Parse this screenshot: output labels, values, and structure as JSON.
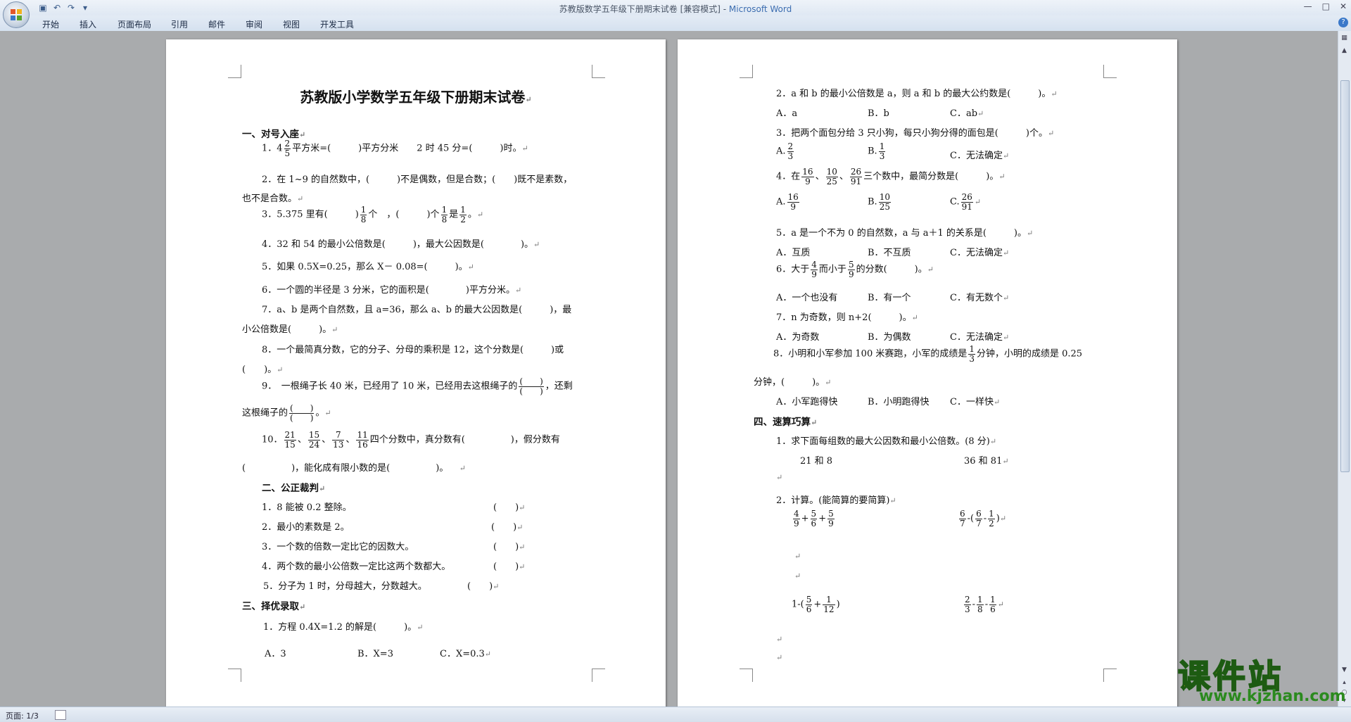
{
  "window": {
    "title": "苏教版数学五年级下册期末试卷 [兼容模式] - ",
    "app_name": "Microsoft Word"
  },
  "ribbon_tabs": [
    "开始",
    "插入",
    "页面布局",
    "引用",
    "邮件",
    "审阅",
    "视图",
    "开发工具"
  ],
  "status_bar": {
    "page": "页面: 1/3"
  },
  "watermark": {
    "text": "课件站",
    "url": "www.kjzhan.com"
  },
  "document": {
    "title": "苏教版小学数学五年级下册期末试卷",
    "left": {
      "s1": "一、对号入座",
      "q1a": "1．4",
      "q1b": "平方米=(　　　)平方分米　　2 时 45 分=(　　　)时。",
      "q2a": "2．在 1~9 的自然数中，(　　　)不是偶数，但是合数；(　　)既不是素数，",
      "q2b": "也不是合数。",
      "q3a": "3．5.375 里有(　　　)",
      "q3b": "个　，(　　　)个",
      "q3c": "是",
      "q3d": "。",
      "q4": "4．32 和 54 的最小公倍数是(　　　)，最大公因数是(　　　　)。",
      "q5": "5．如果 0.5X=0.25，那么 X－ 0.08=(　　　)。",
      "q6": "6．一个圆的半径是 3 分米，它的面积是(　　　　)平方分米。",
      "q7a": "7．a、b 是两个自然数，且 a=36，那么 a、b 的最大公因数是(　　　)，最",
      "q7b": "小公倍数是(　　　)。",
      "q8a": "8．一个最简真分数，它的分子、分母的乘积是 12，这个分数是(　　　)或",
      "q8b": "(　　)。",
      "q9a": "9．　一根绳子长 40 米，已经用了 10 米，已经用去这根绳子的",
      "q9b": "，还剩",
      "q9c": "这根绳子的",
      "q9d": "。",
      "q10a": "10．",
      "q10b": "四个分数中，真分数有(　　　　　)，假分数有",
      "q10c": "(　　　　　)，能化成有限小数的是(　　　　　)。",
      "s2": "二、公正裁判",
      "j1": "1．8 能被 0.2 整除。",
      "j2": "2．最小的素数是 2。",
      "j3": "3．一个数的倍数一定比它的因数大。",
      "j4": "4．两个数的最小公倍数一定比这两个数都大。",
      "j5": "5．分子为 1 时，分母越大，分数越大。",
      "blank": "(　　)",
      "s3": "三、择优录取",
      "c1": "1．方程 0.4X=1.2 的解是(　　　)。",
      "c1a": "A．3",
      "c1b": "B．X=3",
      "c1c": "C．X=0.3"
    },
    "right": {
      "c2": "2．a 和 b 的最小公倍数是 a，则 a 和 b 的最大公约数是(　　　)。",
      "c2a": "A．a",
      "c2b": "B．b",
      "c2c": "C．ab",
      "c3": "3．把两个面包分给 3 只小狗，每只小狗分得的面包是(　　　)个。",
      "c3a": "A.",
      "c3b": "B.",
      "c3c": "C．无法确定",
      "c4a": "4．在",
      "c4b": "三个数中，最简分数是(　　　)。",
      "c4oa": "A.",
      "c4ob": "B.",
      "c4oc": "C.",
      "c5": "5．a 是一个不为 0 的自然数，a 与 a＋1 的关系是(　　　)。",
      "c5a": "A．互质",
      "c5b": "B．不互质",
      "c5c": "C．无法确定",
      "c6a": "6．大于",
      "c6b": "而小于",
      "c6c": "的分数(　　　)。",
      "c6oa": "A．一个也没有",
      "c6ob": "B．有一个",
      "c6oc": "C．有无数个",
      "c7": "7．n 为奇数，则 n+2(　　　)。",
      "c7a": "A．为奇数",
      "c7b": "B．为偶数",
      "c7c": "C．无法确定",
      "c8a": "8．小明和小军参加 100 米赛跑，小军的成绩是",
      "c8b": "分钟，小明的成绩是 0.25",
      "c8c": "分钟，(　　　)。",
      "c8oa": "A．小军跑得快",
      "c8ob": "B．小明跑得快",
      "c8oc": "C．一样快",
      "s4": "四、速算巧算",
      "k1": "1．求下面每组数的最大公因数和最小公倍数。(8 分)",
      "k1a": "21 和 8",
      "k1b": "36 和 81",
      "k2": "2．计算。(能简算的要简算)",
      "plus": "+",
      "minus": "-",
      "lp": "(",
      "rp": ")",
      "one_minus_lp": "1-(",
      "minus_lp": "-("
    },
    "fractions": {
      "two_fifths": {
        "n": "2",
        "d": "5"
      },
      "one_eighth": {
        "n": "1",
        "d": "8"
      },
      "one_half": {
        "n": "1",
        "d": "2"
      },
      "blank": {
        "n": "(　　)",
        "d": "(　　)"
      },
      "f21_15": {
        "n": "21",
        "d": "15"
      },
      "f15_24": {
        "n": "15",
        "d": "24"
      },
      "f7_13": {
        "n": "7",
        "d": "13"
      },
      "f11_16": {
        "n": "11",
        "d": "16"
      },
      "two_thirds": {
        "n": "2",
        "d": "3"
      },
      "one_third": {
        "n": "1",
        "d": "3"
      },
      "f16_9": {
        "n": "16",
        "d": "9"
      },
      "f10_25": {
        "n": "10",
        "d": "25"
      },
      "f26_91": {
        "n": "26",
        "d": "91"
      },
      "four_ninths": {
        "n": "4",
        "d": "9"
      },
      "five_ninths": {
        "n": "5",
        "d": "9"
      },
      "five_sixths": {
        "n": "5",
        "d": "6"
      },
      "six_sevenths": {
        "n": "6",
        "d": "7"
      },
      "one_twelfth": {
        "n": "1",
        "d": "12"
      },
      "one_sixth": {
        "n": "1",
        "d": "6"
      }
    }
  }
}
